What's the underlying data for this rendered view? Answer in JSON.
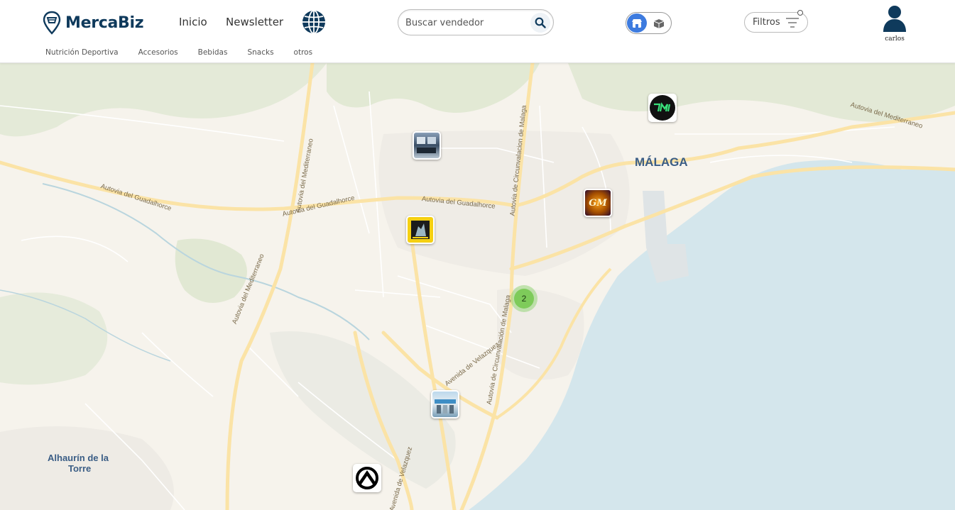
{
  "brand": {
    "name": "MercaBiz",
    "accent": "#0f3a5c"
  },
  "nav": {
    "home": "Inicio",
    "newsletter": "Newsletter"
  },
  "search": {
    "placeholder": "Buscar vendedor",
    "value": ""
  },
  "filters": {
    "label": "Filtros"
  },
  "user": {
    "name": "carlos"
  },
  "view_toggle": {
    "selected": "stores",
    "selected_color": "#3d7bdf"
  },
  "categories": [
    "Nutrición Deportiva",
    "Accesorios",
    "Bebidas",
    "Snacks",
    "otros"
  ],
  "map": {
    "place_labels": {
      "malaga": "MÁLAGA",
      "alhaurin_line1": "Alhaurín de la",
      "alhaurin_line2": "Torre"
    },
    "road_labels": {
      "guadalhorce_1": "Autovia del Guadalhorce",
      "guadalhorce_2": "Autovia del Guadalhorce",
      "guadalhorce_3": "Autovia del Guadalhorce",
      "mediterraneo_1": "Autovia del Mediterraneo",
      "mediterraneo_2": "Autovia del Mediterraneo",
      "mediterraneo_3": "Autovia del Mediterraneo",
      "circunvalacion_1": "Autovia de Circunvalacion de Malaga",
      "circunvalacion_2": "Autovia de Circunvalación de Malaga",
      "velazquez_1": "Avenida de Velazquez",
      "velazquez_2": "Avenida de Velazquez"
    },
    "cluster_count": "2",
    "vendor_markers": [
      {
        "name": "vendor-1",
        "icon": "tm-logo"
      },
      {
        "name": "vendor-2",
        "icon": "store-photo"
      },
      {
        "name": "vendor-3",
        "icon": "gm-logo"
      },
      {
        "name": "vendor-4",
        "icon": "fitness-logo-yellow"
      },
      {
        "name": "vendor-5",
        "icon": "storefront-photo"
      },
      {
        "name": "vendor-6",
        "icon": "arrow-logo"
      }
    ]
  }
}
